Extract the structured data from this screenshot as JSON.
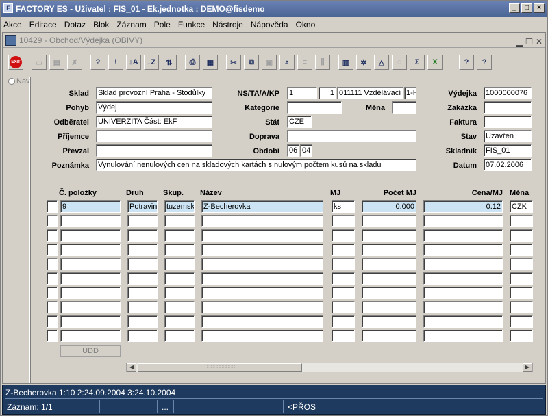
{
  "window": {
    "title": "FACTORY ES - Uživatel : FIS_01 - Ek.jednotka : DEMO@fisdemo"
  },
  "menu": [
    "Akce",
    "Editace",
    "Dotaz",
    "Blok",
    "Záznam",
    "Pole",
    "Funkce",
    "Nástroje",
    "Nápověda",
    "Okno"
  ],
  "form": {
    "title": "10429 - Obchod/Výdejka (OBIVY)"
  },
  "toolbar": {
    "exit_label": "EXIT",
    "sigma_label": "Σ",
    "help_label": "?"
  },
  "nav": {
    "label": "Nav"
  },
  "header": {
    "sklad_label": "Sklad",
    "sklad": "Sklad provozní Praha - Stodůlky",
    "pohyb_label": "Pohyb",
    "pohyb": "Výdej",
    "odberatel_label": "Odběratel",
    "odberatel": "UNIVERZITA Část: EkF",
    "prijemce_label": "Příjemce",
    "prijemce": "",
    "prevzal_label": "Převzal",
    "prevzal": "",
    "poznamka_label": "Poznámka",
    "poznamka": "Vynulování nenulových cen na skladových kartách s nulovým počtem kusů na skladu",
    "nstakp_label": "NS/TA/A/KP",
    "ns": "1",
    "ta": "1",
    "a": "011111 Vzdělávací",
    "kp": "1-H",
    "kategorie_label": "Kategorie",
    "kategorie": "",
    "mena_label": "Měna",
    "mena": "",
    "stat_label": "Stát",
    "stat": "CZE",
    "doprava_label": "Doprava",
    "doprava": "",
    "obdobi_label": "Období",
    "obdobi_m": "06",
    "obdobi_p": "04",
    "vydejka_label": "Výdejka",
    "vydejka": "1000000076",
    "zakazka_label": "Zakázka",
    "zakazka": "",
    "faktura_label": "Faktura",
    "faktura": "",
    "stav_label": "Stav",
    "stav": "Uzavřen",
    "skladnik_label": "Skladník",
    "skladnik": "FIS_01",
    "datum_label": "Datum",
    "datum": "07.02.2006"
  },
  "grid": {
    "columns": [
      "Č. položky",
      "Druh",
      "Skup.",
      "Název",
      "MJ",
      "Počet MJ",
      "Cena/MJ",
      "Měna"
    ],
    "rows": [
      [
        "9",
        "Potraviny",
        "tuzemsk",
        "Z-Becherovka",
        "ks",
        "0.000",
        "0.12",
        "CZK"
      ]
    ],
    "udd_label": "UDD"
  },
  "status": {
    "line1": "Z-Becherovka 1:10 2:24.09.2004 3:24.10.2004",
    "record": "Záznam: 1/1",
    "seg3": "...",
    "seg5": "<PŘOS"
  }
}
